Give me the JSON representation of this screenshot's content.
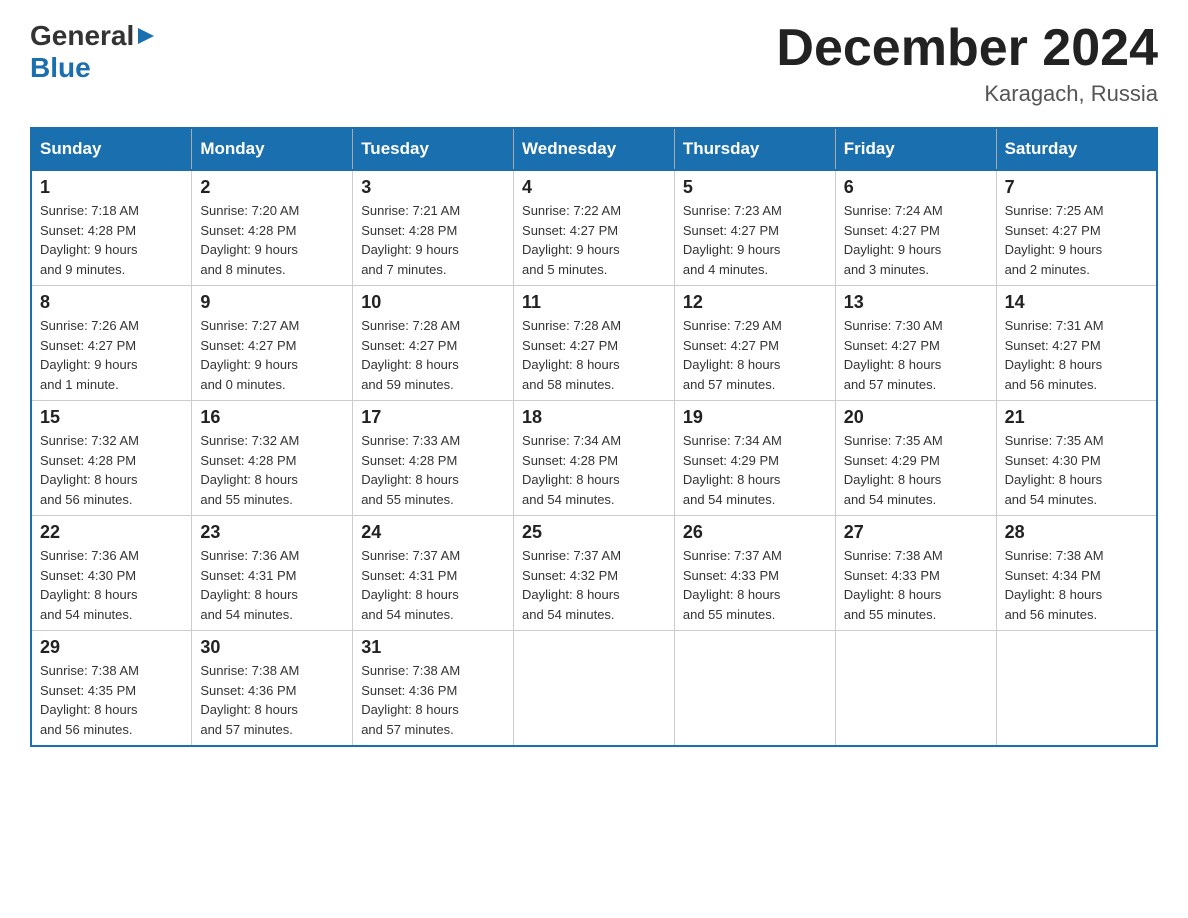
{
  "header": {
    "logo_general": "General",
    "logo_blue": "Blue",
    "month_title": "December 2024",
    "location": "Karagach, Russia"
  },
  "columns": [
    "Sunday",
    "Monday",
    "Tuesday",
    "Wednesday",
    "Thursday",
    "Friday",
    "Saturday"
  ],
  "weeks": [
    [
      {
        "day": "1",
        "info": "Sunrise: 7:18 AM\nSunset: 4:28 PM\nDaylight: 9 hours\nand 9 minutes."
      },
      {
        "day": "2",
        "info": "Sunrise: 7:20 AM\nSunset: 4:28 PM\nDaylight: 9 hours\nand 8 minutes."
      },
      {
        "day": "3",
        "info": "Sunrise: 7:21 AM\nSunset: 4:28 PM\nDaylight: 9 hours\nand 7 minutes."
      },
      {
        "day": "4",
        "info": "Sunrise: 7:22 AM\nSunset: 4:27 PM\nDaylight: 9 hours\nand 5 minutes."
      },
      {
        "day": "5",
        "info": "Sunrise: 7:23 AM\nSunset: 4:27 PM\nDaylight: 9 hours\nand 4 minutes."
      },
      {
        "day": "6",
        "info": "Sunrise: 7:24 AM\nSunset: 4:27 PM\nDaylight: 9 hours\nand 3 minutes."
      },
      {
        "day": "7",
        "info": "Sunrise: 7:25 AM\nSunset: 4:27 PM\nDaylight: 9 hours\nand 2 minutes."
      }
    ],
    [
      {
        "day": "8",
        "info": "Sunrise: 7:26 AM\nSunset: 4:27 PM\nDaylight: 9 hours\nand 1 minute."
      },
      {
        "day": "9",
        "info": "Sunrise: 7:27 AM\nSunset: 4:27 PM\nDaylight: 9 hours\nand 0 minutes."
      },
      {
        "day": "10",
        "info": "Sunrise: 7:28 AM\nSunset: 4:27 PM\nDaylight: 8 hours\nand 59 minutes."
      },
      {
        "day": "11",
        "info": "Sunrise: 7:28 AM\nSunset: 4:27 PM\nDaylight: 8 hours\nand 58 minutes."
      },
      {
        "day": "12",
        "info": "Sunrise: 7:29 AM\nSunset: 4:27 PM\nDaylight: 8 hours\nand 57 minutes."
      },
      {
        "day": "13",
        "info": "Sunrise: 7:30 AM\nSunset: 4:27 PM\nDaylight: 8 hours\nand 57 minutes."
      },
      {
        "day": "14",
        "info": "Sunrise: 7:31 AM\nSunset: 4:27 PM\nDaylight: 8 hours\nand 56 minutes."
      }
    ],
    [
      {
        "day": "15",
        "info": "Sunrise: 7:32 AM\nSunset: 4:28 PM\nDaylight: 8 hours\nand 56 minutes."
      },
      {
        "day": "16",
        "info": "Sunrise: 7:32 AM\nSunset: 4:28 PM\nDaylight: 8 hours\nand 55 minutes."
      },
      {
        "day": "17",
        "info": "Sunrise: 7:33 AM\nSunset: 4:28 PM\nDaylight: 8 hours\nand 55 minutes."
      },
      {
        "day": "18",
        "info": "Sunrise: 7:34 AM\nSunset: 4:28 PM\nDaylight: 8 hours\nand 54 minutes."
      },
      {
        "day": "19",
        "info": "Sunrise: 7:34 AM\nSunset: 4:29 PM\nDaylight: 8 hours\nand 54 minutes."
      },
      {
        "day": "20",
        "info": "Sunrise: 7:35 AM\nSunset: 4:29 PM\nDaylight: 8 hours\nand 54 minutes."
      },
      {
        "day": "21",
        "info": "Sunrise: 7:35 AM\nSunset: 4:30 PM\nDaylight: 8 hours\nand 54 minutes."
      }
    ],
    [
      {
        "day": "22",
        "info": "Sunrise: 7:36 AM\nSunset: 4:30 PM\nDaylight: 8 hours\nand 54 minutes."
      },
      {
        "day": "23",
        "info": "Sunrise: 7:36 AM\nSunset: 4:31 PM\nDaylight: 8 hours\nand 54 minutes."
      },
      {
        "day": "24",
        "info": "Sunrise: 7:37 AM\nSunset: 4:31 PM\nDaylight: 8 hours\nand 54 minutes."
      },
      {
        "day": "25",
        "info": "Sunrise: 7:37 AM\nSunset: 4:32 PM\nDaylight: 8 hours\nand 54 minutes."
      },
      {
        "day": "26",
        "info": "Sunrise: 7:37 AM\nSunset: 4:33 PM\nDaylight: 8 hours\nand 55 minutes."
      },
      {
        "day": "27",
        "info": "Sunrise: 7:38 AM\nSunset: 4:33 PM\nDaylight: 8 hours\nand 55 minutes."
      },
      {
        "day": "28",
        "info": "Sunrise: 7:38 AM\nSunset: 4:34 PM\nDaylight: 8 hours\nand 56 minutes."
      }
    ],
    [
      {
        "day": "29",
        "info": "Sunrise: 7:38 AM\nSunset: 4:35 PM\nDaylight: 8 hours\nand 56 minutes."
      },
      {
        "day": "30",
        "info": "Sunrise: 7:38 AM\nSunset: 4:36 PM\nDaylight: 8 hours\nand 57 minutes."
      },
      {
        "day": "31",
        "info": "Sunrise: 7:38 AM\nSunset: 4:36 PM\nDaylight: 8 hours\nand 57 minutes."
      },
      {
        "day": "",
        "info": ""
      },
      {
        "day": "",
        "info": ""
      },
      {
        "day": "",
        "info": ""
      },
      {
        "day": "",
        "info": ""
      }
    ]
  ]
}
